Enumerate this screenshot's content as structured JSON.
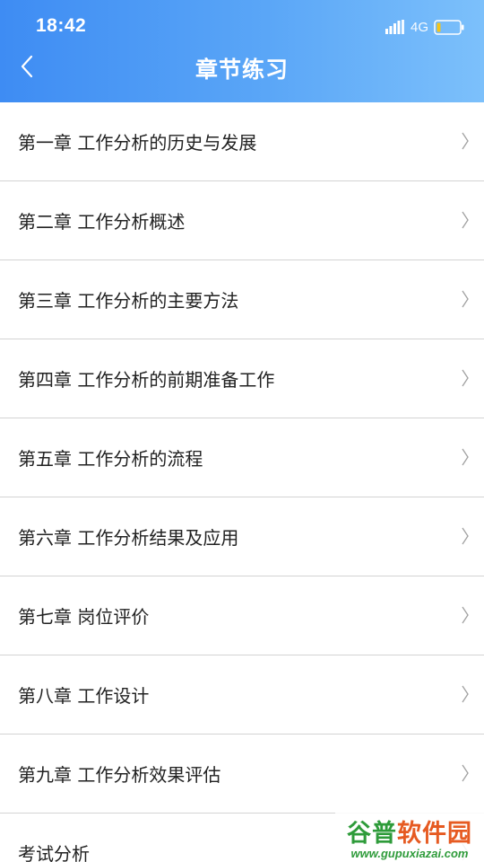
{
  "status_bar": {
    "time": "18:42",
    "network": "4G",
    "icons": [
      "signal-icon",
      "battery-icon"
    ]
  },
  "header": {
    "title": "章节练习",
    "back_icon": "chevron-left-icon"
  },
  "chapters": [
    {
      "label": "第一章 工作分析的历史与发展"
    },
    {
      "label": "第二章 工作分析概述"
    },
    {
      "label": "第三章 工作分析的主要方法"
    },
    {
      "label": "第四章 工作分析的前期准备工作"
    },
    {
      "label": "第五章 工作分析的流程"
    },
    {
      "label": "第六章 工作分析结果及应用"
    },
    {
      "label": "第七章 岗位评价"
    },
    {
      "label": "第八章 工作设计"
    },
    {
      "label": "第九章 工作分析效果评估"
    },
    {
      "label": "考试分析"
    }
  ],
  "watermark": {
    "logo_part1": "谷普",
    "logo_part2": "软件园",
    "url": "www.gupuxiazai.com"
  },
  "colors": {
    "header_gradient_start": "#3e8cf3",
    "header_gradient_end": "#7cc0fb",
    "divider": "#d3d3d3",
    "chevron": "#a0a0a0",
    "text": "#222222"
  }
}
